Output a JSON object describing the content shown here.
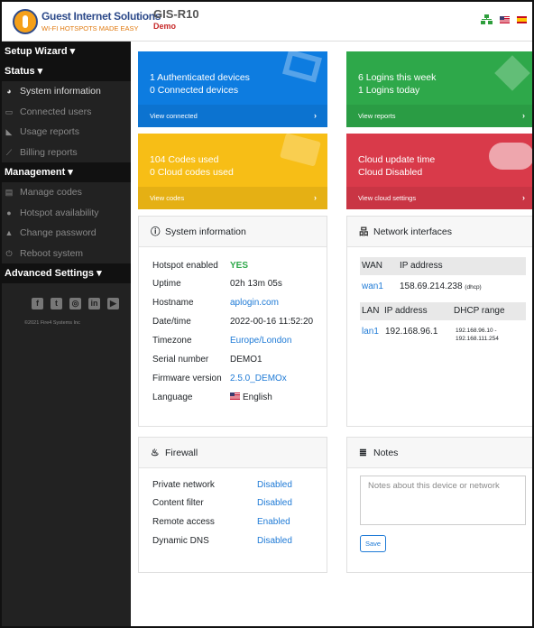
{
  "header": {
    "logo_title": "Guest Internet Solutions",
    "logo_tagline": "WI-FI HOTSPOTS MADE EASY",
    "device_name": "GIS-R10",
    "device_mode": "Demo",
    "icons": [
      "network-icon",
      "us-flag-icon",
      "es-flag-icon"
    ]
  },
  "sidebar": {
    "setup_wizard": "Setup Wizard ▾",
    "status": "Status ▾",
    "status_items": [
      {
        "label": "System information",
        "icon": "dashboard-icon"
      },
      {
        "label": "Connected users",
        "icon": "laptop-icon"
      },
      {
        "label": "Usage reports",
        "icon": "area-chart-icon"
      },
      {
        "label": "Billing reports",
        "icon": "line-chart-icon"
      }
    ],
    "management": "Management ▾",
    "management_items": [
      {
        "label": "Manage codes",
        "icon": "ticket-icon"
      },
      {
        "label": "Hotspot availability",
        "icon": "clock-icon"
      },
      {
        "label": "Change password",
        "icon": "lock-icon"
      },
      {
        "label": "Reboot system",
        "icon": "power-icon"
      }
    ],
    "advanced": "Advanced Settings ▾",
    "social_icons": [
      "facebook-icon",
      "twitter-icon",
      "instagram-icon",
      "linkedin-icon",
      "youtube-icon"
    ],
    "copyright": "©2021 Fire4 Systems Inc"
  },
  "tiles": {
    "devices": {
      "line1": "1 Authenticated devices",
      "line2": "0 Connected devices",
      "footer": "View connected",
      "arrow": "›",
      "color": "#0d7ce0"
    },
    "logins": {
      "line1": "6 Logins this week",
      "line2": "1 Logins today",
      "footer": "View reports",
      "arrow": "›",
      "color": "#2ea84a"
    },
    "codes": {
      "line1": "104 Codes used",
      "line2": "0 Cloud codes used",
      "footer": "View codes",
      "arrow": "›",
      "color": "#f7be16"
    },
    "cloud": {
      "line1": "Cloud update time",
      "line2": "Cloud Disabled",
      "footer": "View cloud settings",
      "arrow": "›",
      "color": "#d93a4a"
    }
  },
  "system_info": {
    "title": "System information",
    "rows": [
      {
        "key": "Hotspot enabled",
        "value": "YES"
      },
      {
        "key": "Uptime",
        "value": "02h 13m 05s"
      },
      {
        "key": "Hostname",
        "value": "aplogin.com"
      },
      {
        "key": "Date/time",
        "value": "2022-00-16 11:52:20"
      },
      {
        "key": "Timezone",
        "value": "Europe/London"
      },
      {
        "key": "Serial number",
        "value": "DEMO1"
      },
      {
        "key": "Firmware version",
        "value": "2.5.0_DEMOx"
      },
      {
        "key": "Language",
        "value": "English"
      }
    ]
  },
  "network": {
    "title": "Network interfaces",
    "wan_header": {
      "col1": "WAN",
      "col2": "IP address"
    },
    "wan_row": {
      "iface": "wan1",
      "ip": "158.69.214.238",
      "mode": "(dhcp)"
    },
    "lan_header": {
      "col1": "LAN",
      "col2": "IP address",
      "col3": "DHCP range"
    },
    "lan_row": {
      "iface": "lan1",
      "ip": "192.168.96.1",
      "range_start": "192.168.96.10 -",
      "range_end": "192.168.111.254"
    }
  },
  "firewall": {
    "title": "Firewall",
    "rows": [
      {
        "key": "Private network",
        "value": "Disabled"
      },
      {
        "key": "Content filter",
        "value": "Disabled"
      },
      {
        "key": "Remote access",
        "value": "Enabled"
      },
      {
        "key": "Dynamic DNS",
        "value": "Disabled"
      }
    ]
  },
  "notes": {
    "title": "Notes",
    "placeholder": "Notes about this device or network",
    "save_label": "Save"
  }
}
